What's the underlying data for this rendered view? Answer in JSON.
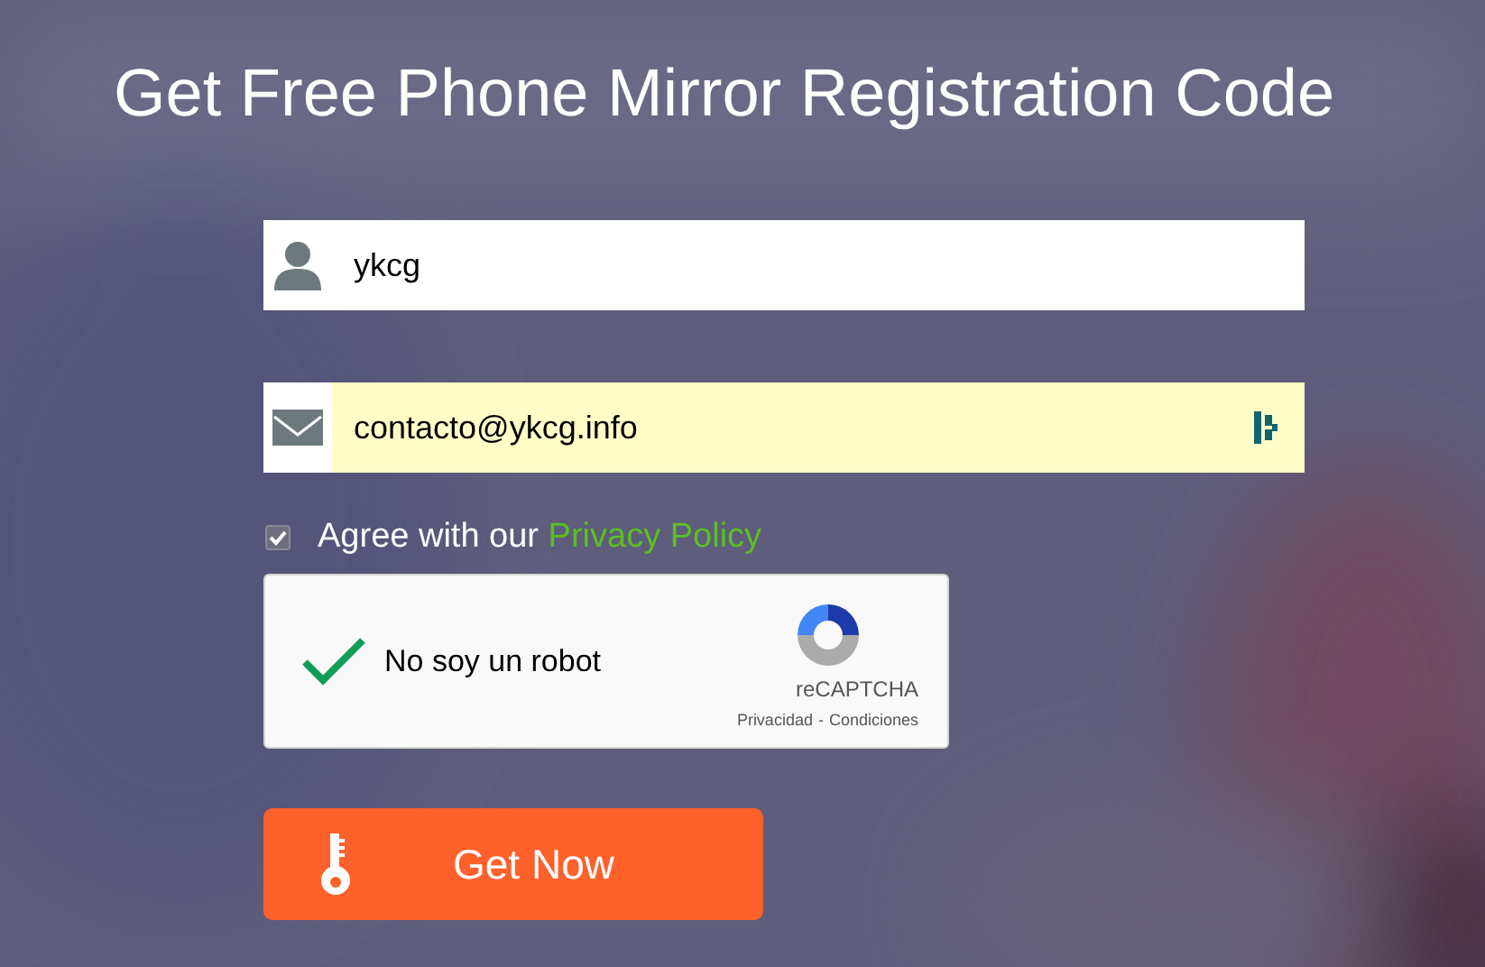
{
  "title": "Get Free Phone Mirror Registration Code",
  "fields": [
    {
      "kind": "user",
      "value": "ykcg",
      "autofilled": false
    },
    {
      "kind": "email",
      "value": "contacto@ykcg.info",
      "autofilled": true
    }
  ],
  "agree": {
    "checked": true,
    "text": "Agree with our",
    "link": "Privacy Policy"
  },
  "captcha": {
    "checked": true,
    "label": "No soy un robot",
    "brand": "reCAPTCHA",
    "privacy": "Privacidad",
    "separator": "-",
    "terms": "Condiciones"
  },
  "button": {
    "label": "Get Now"
  }
}
